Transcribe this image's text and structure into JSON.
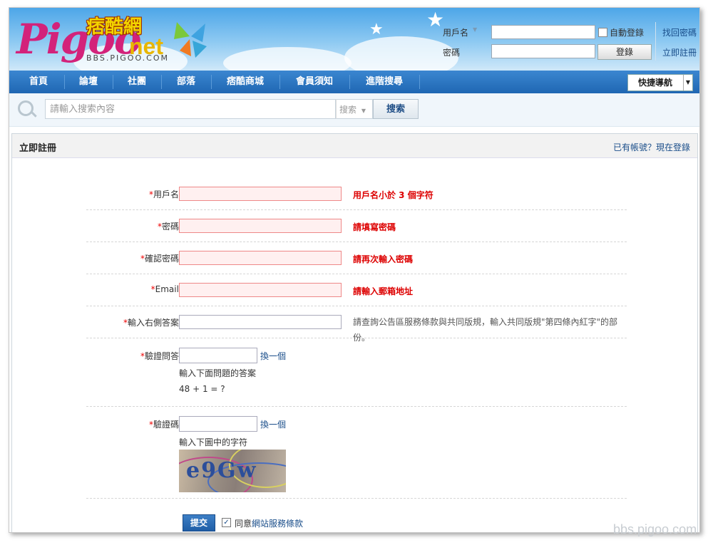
{
  "header": {
    "logo_text": "Pigoo",
    "logo_net": "net",
    "logo_cn": "痞酷網",
    "logo_url": "BBS.PIGOO.COM",
    "username_label": "用戶名",
    "auto_login_label": "自動登錄",
    "find_password": "找回密碼",
    "password_label": "密碼",
    "login_button": "登錄",
    "register_link": "立即註冊"
  },
  "nav": {
    "items": [
      "首頁",
      "論壇",
      "社團",
      "部落",
      "痞酷商城",
      "會員須知",
      "進階搜尋"
    ],
    "quick_nav": "快捷導航"
  },
  "search": {
    "placeholder": "請輸入搜索內容",
    "scope": "搜索",
    "button": "搜索"
  },
  "panel": {
    "title": "立即註冊",
    "has_account": "已有帳號？現在登錄"
  },
  "form": {
    "required_mark": "*",
    "username": {
      "label": "用戶名:",
      "error": "用戶名小於 3 個字符"
    },
    "password": {
      "label": "密碼:",
      "error": "請填寫密碼"
    },
    "confirm": {
      "label": "確認密碼:",
      "error": "請再次輸入密碼"
    },
    "email": {
      "label": "Email:",
      "error": "請輸入郵箱地址"
    },
    "answer": {
      "label": "輸入右側答案:",
      "hint": "請查詢公告區服務條款與共同版規，輸入共同版規\"第四條內紅字\"的部份。"
    },
    "question": {
      "label": "驗證問答:",
      "swap": "換一個",
      "note": "輸入下面問題的答案",
      "question": "48 + 1 = ?"
    },
    "captcha": {
      "label": "驗證碼:",
      "swap": "換一個",
      "note": "輸入下圖中的字符",
      "image_text": "e9Gw"
    },
    "submit": "提交",
    "agree_prefix": "同意",
    "agree_link": "網站服務條款"
  },
  "watermark": "bbs.pigoo.com"
}
